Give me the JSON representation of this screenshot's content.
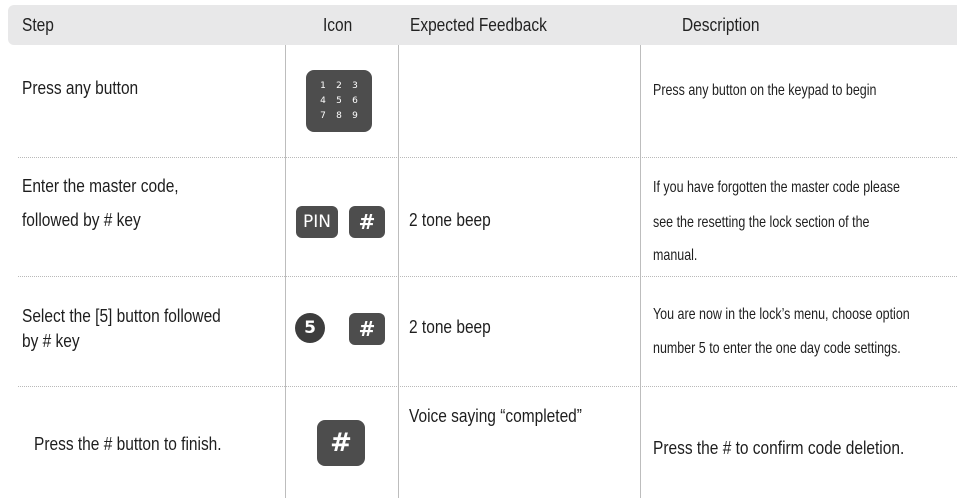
{
  "header": {
    "step": "Step",
    "icon": "Icon",
    "feedback": "Expected Feedback",
    "description": "Description"
  },
  "rows": [
    {
      "step_lines": [
        "Press any button"
      ],
      "icons": [
        "keypad-icon"
      ],
      "keypad_digits": [
        "1",
        "2",
        "3",
        "4",
        "5",
        "6",
        "7",
        "8",
        "9"
      ],
      "feedback": "",
      "description_lines": [
        "Press any button on the keypad to begin"
      ]
    },
    {
      "step_lines": [
        "Enter the master code,",
        "followed by # key"
      ],
      "icons": [
        "pin-icon",
        "hash-key-icon"
      ],
      "pin_label": "PIN",
      "hash_label": "#",
      "feedback": "2 tone beep",
      "description_lines": [
        "If you have forgotten the master code please",
        "see the resetting the lock section of the",
        "manual."
      ]
    },
    {
      "step_lines": [
        "Select the [5] button followed",
        "by # key"
      ],
      "icons": [
        "digit-5-icon",
        "hash-key-icon"
      ],
      "digit_label": "5",
      "hash_label": "#",
      "feedback": "2 tone beep",
      "description_lines": [
        "You are now in the lock’s menu, choose option",
        "number 5 to enter the one day code settings."
      ]
    },
    {
      "step_lines": [
        "Press the # button to finish."
      ],
      "icons": [
        "hash-key-icon"
      ],
      "hash_label": "#",
      "feedback": "Voice saying “completed”",
      "description_lines": [
        "Press the # to confirm code deletion."
      ]
    }
  ],
  "colors": {
    "header_bg": "#e8e8e9",
    "icon_bg": "#4d4d4d",
    "text": "#1e1e1e",
    "divider": "#bdbdbd"
  }
}
